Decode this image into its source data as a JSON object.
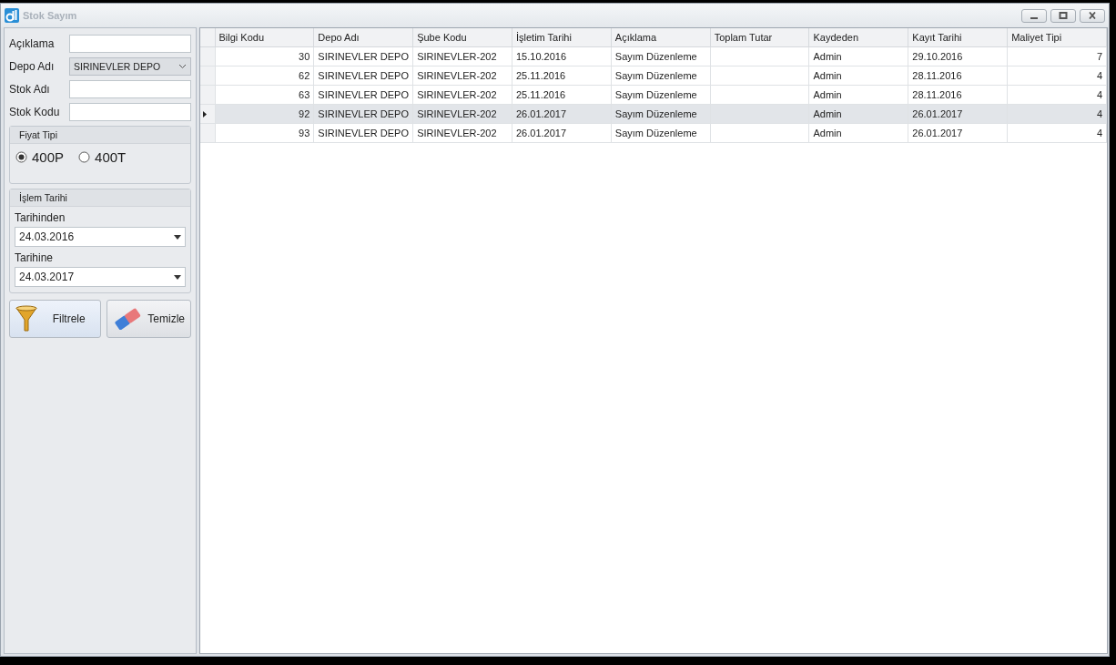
{
  "window": {
    "title": "Stok Sayım"
  },
  "filters": {
    "fields": [
      {
        "label": "Açıklama",
        "kind": "text"
      },
      {
        "label": "Depo Adı",
        "kind": "combo",
        "value": "SIRINEVLER DEPO"
      },
      {
        "label": "Stok Adı",
        "kind": "text"
      },
      {
        "label": "Stok Kodu",
        "kind": "text"
      }
    ],
    "price_type": {
      "title": "Fiyat Tipi",
      "options": [
        {
          "label": "400P",
          "selected": true
        },
        {
          "label": "400T",
          "selected": false
        }
      ]
    },
    "date_group": {
      "title": "İşlem Tarihi",
      "from_label": "Tarihinden",
      "from_value": "24.03.2016",
      "to_label": "Tarihine",
      "to_value": "24.03.2017"
    },
    "buttons": [
      {
        "label": "Filtrele",
        "kind": "filter"
      },
      {
        "label": "Temizle",
        "kind": "clear"
      }
    ]
  },
  "table": {
    "columns": [
      "Bilgi Kodu",
      "Depo Adı",
      "Şube Kodu",
      "İşletim Tarihi",
      "Açıklama",
      "Toplam Tutar",
      "Kaydeden",
      "Kayıt Tarihi",
      "Maliyet Tipi"
    ],
    "rows": [
      {
        "selected": false,
        "cells": [
          "30",
          "SIRINEVLER DEPO",
          "SIRINEVLER-202",
          "15.10.2016",
          "Sayım Düzenleme",
          "",
          "Admin",
          "29.10.2016",
          "7"
        ]
      },
      {
        "selected": false,
        "cells": [
          "62",
          "SIRINEVLER DEPO",
          "SIRINEVLER-202",
          "25.11.2016",
          "Sayım Düzenleme",
          "",
          "Admin",
          "28.11.2016",
          "4"
        ]
      },
      {
        "selected": false,
        "cells": [
          "63",
          "SIRINEVLER DEPO",
          "SIRINEVLER-202",
          "25.11.2016",
          "Sayım Düzenleme",
          "",
          "Admin",
          "28.11.2016",
          "4"
        ]
      },
      {
        "selected": true,
        "cells": [
          "92",
          "SIRINEVLER DEPO",
          "SIRINEVLER-202",
          "26.01.2017",
          "Sayım Düzenleme",
          "",
          "Admin",
          "26.01.2017",
          "4"
        ]
      },
      {
        "selected": false,
        "cells": [
          "93",
          "SIRINEVLER DEPO",
          "SIRINEVLER-202",
          "26.01.2017",
          "Sayım Düzenleme",
          "",
          "Admin",
          "26.01.2017",
          "4"
        ]
      }
    ]
  }
}
